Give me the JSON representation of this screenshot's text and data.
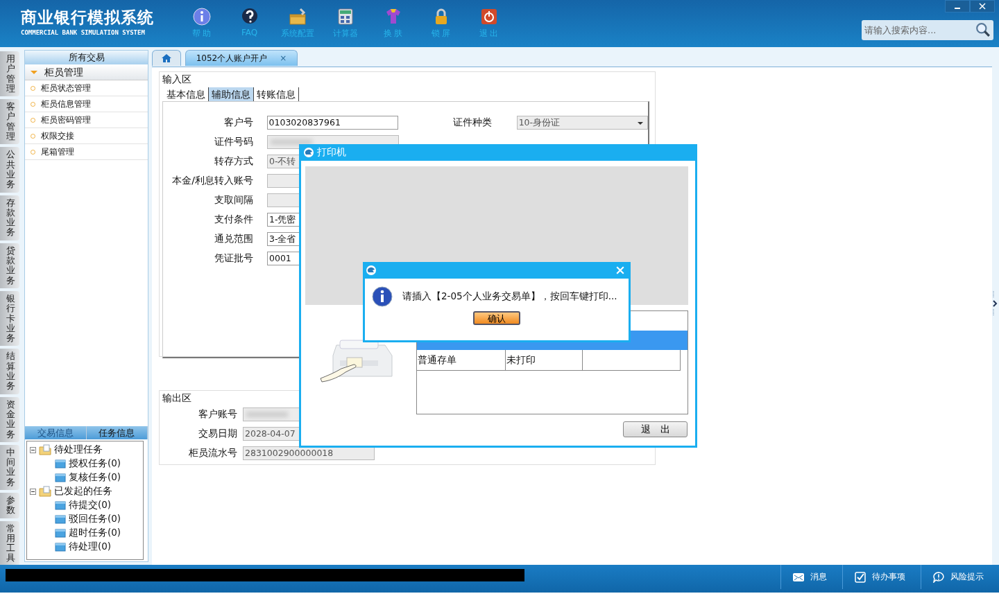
{
  "header": {
    "title": "商业银行模拟系统",
    "subtitle": "COMMERCIAL BANK SIMULATION SYSTEM",
    "tools": [
      {
        "kind": "help",
        "label": "帮 助"
      },
      {
        "kind": "faq",
        "label": "FAQ"
      },
      {
        "kind": "config",
        "label": "系统配置"
      },
      {
        "kind": "calc",
        "label": "计算器"
      },
      {
        "kind": "skin",
        "label": "换 肤"
      },
      {
        "kind": "lock",
        "label": "锁 屏"
      },
      {
        "kind": "exit",
        "label": "退 出"
      }
    ],
    "search": {
      "placeholder": "请输入搜索内容..."
    }
  },
  "nav_tabs": [
    "用户管理",
    "客户管理",
    "公共业务",
    "存款业务",
    "贷款业务",
    "银行卡业务",
    "结算业务",
    "资金业务",
    "中间业务",
    "参数",
    "常用工具"
  ],
  "sidebar": {
    "title": "所有交易",
    "group": {
      "label": "柜员管理",
      "expanded": true
    },
    "items": [
      "柜员状态管理",
      "柜员信息管理",
      "柜员密码管理",
      "权限交接",
      "尾箱管理"
    ],
    "panel_tabs": [
      {
        "label": "交易信息",
        "selected": false
      },
      {
        "label": "任务信息",
        "selected": true
      }
    ],
    "tree": [
      {
        "label": "待处理任务",
        "expanded": true,
        "children": [
          {
            "label": "授权任务(0)"
          },
          {
            "label": "复核任务(0)"
          }
        ]
      },
      {
        "label": "已发起的任务",
        "expanded": true,
        "children": [
          {
            "label": "待提交(0)"
          },
          {
            "label": "驳回任务(0)"
          },
          {
            "label": "超时任务(0)"
          },
          {
            "label": "待处理(0)"
          }
        ]
      }
    ]
  },
  "doc_tabs": [
    {
      "kind": "home",
      "selected": false
    },
    {
      "kind": "page",
      "label": "1052个人账户开户",
      "close": "×",
      "selected": true
    }
  ],
  "input_area": {
    "title": "输入区",
    "tabs": [
      {
        "label": "基本信息",
        "selected": false
      },
      {
        "label": "辅助信息",
        "selected": true
      },
      {
        "label": "转账信息",
        "selected": false
      }
    ],
    "fields": [
      {
        "label": "客户号",
        "value": "0103020837961",
        "kind": "text"
      },
      {
        "label": "证件号码",
        "kind": "blurred"
      },
      {
        "label": "转存方式",
        "value": "0-不转",
        "kind": "grey"
      },
      {
        "label": "本金/利息转入账号",
        "kind": "grey"
      },
      {
        "label": "支取间隔",
        "kind": "grey"
      },
      {
        "label": "支付条件",
        "value": "1-凭密",
        "kind": "text"
      },
      {
        "label": "通兑范围",
        "value": "3-全省",
        "kind": "text"
      },
      {
        "label": "凭证批号",
        "value": "0001",
        "kind": "text"
      }
    ],
    "side_field": {
      "label": "证件种类",
      "value": "10-身份证",
      "kind": "select"
    }
  },
  "output_area": {
    "title": "输出区",
    "fields": [
      {
        "label": "客户账号",
        "kind": "blurred"
      },
      {
        "label": "交易日期",
        "value": "2028-04-07",
        "kind": "grey"
      },
      {
        "label": "柜员流水号",
        "value": "2831002900000018",
        "kind": "grey"
      }
    ]
  },
  "printer_dialog": {
    "title": "打印机",
    "rows": [
      {
        "cells": [
          "普通存单",
          "未打印"
        ]
      }
    ],
    "exit_button": "退　出"
  },
  "message_box": {
    "message": "请插入【2-05个人业务交易单】，按回车键打印...",
    "confirm": "确认"
  },
  "status_bar": [
    {
      "kind": "mail",
      "label": "消息"
    },
    {
      "kind": "todo",
      "label": "待办事项"
    },
    {
      "kind": "risk",
      "label": "风险提示"
    }
  ]
}
